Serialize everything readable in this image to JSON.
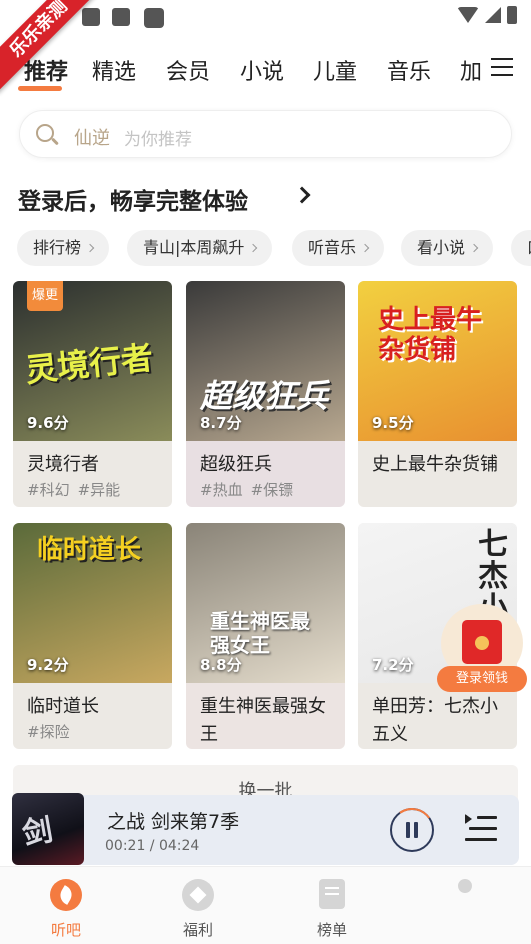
{
  "app": {
    "ribbon_text": "乐乐亲测"
  },
  "tabs": [
    {
      "label": "推荐",
      "active": true
    },
    {
      "label": "精选"
    },
    {
      "label": "会员"
    },
    {
      "label": "小说"
    },
    {
      "label": "儿童"
    },
    {
      "label": "音乐"
    },
    {
      "label": "加"
    }
  ],
  "search": {
    "value": "仙逆",
    "hint": "为你推荐"
  },
  "login_prompt": "登录后，畅享完整体验",
  "chips": [
    "排行榜",
    "青山|本周飙升",
    "听音乐",
    "看小说",
    "口"
  ],
  "books": [
    {
      "title": "灵境行者",
      "tags": [
        "#科幻",
        "#异能"
      ],
      "score": "9.6分",
      "badge": "爆更",
      "cover_text": "灵境行者",
      "colors": [
        "#2b2f2f",
        "#8a8c5a"
      ],
      "accent": "#e8f04a"
    },
    {
      "title": "超级狂兵",
      "tags": [
        "#热血",
        "#保镖"
      ],
      "score": "8.7分",
      "cover_text": "超级狂兵",
      "colors": [
        "#3a3a3a",
        "#b8a890"
      ],
      "accent": "#ffffff"
    },
    {
      "title": "史上最牛杂货铺",
      "tags": [],
      "score": "9.5分",
      "cover_text": "史上最牛杂货铺",
      "colors": [
        "#f2d040",
        "#e89030"
      ],
      "accent": "#d82020"
    },
    {
      "title": "临时道长",
      "tags": [
        "#探险"
      ],
      "score": "9.2分",
      "cover_text": "临时道长",
      "colors": [
        "#5a6a3a",
        "#c8a860"
      ],
      "accent": "#f5d020"
    },
    {
      "title": "重生神医最强女王",
      "tags": [],
      "score": "8.8分",
      "cover_text": "重生神医最强女王",
      "colors": [
        "#8a8478",
        "#e4dccc"
      ],
      "accent": "#ffffff"
    },
    {
      "title": "单田芳：七杰小五义",
      "tags": [],
      "score": "7.2分",
      "cover_text": "七杰小",
      "colors": [
        "#f4f4f4",
        "#e8e8e8"
      ],
      "accent": "#222222"
    }
  ],
  "refresh_label": "换一批",
  "reward_label": "登录领钱",
  "player": {
    "marquee": "之战          剑来第7季",
    "time": "00:21 / 04:24",
    "cover_glyph": "剑"
  },
  "bottom_nav": [
    {
      "label": "听吧",
      "icon": "leaf-icon",
      "active": true
    },
    {
      "label": "福利",
      "icon": "diamond-icon"
    },
    {
      "label": "榜单",
      "icon": "list-icon"
    }
  ]
}
